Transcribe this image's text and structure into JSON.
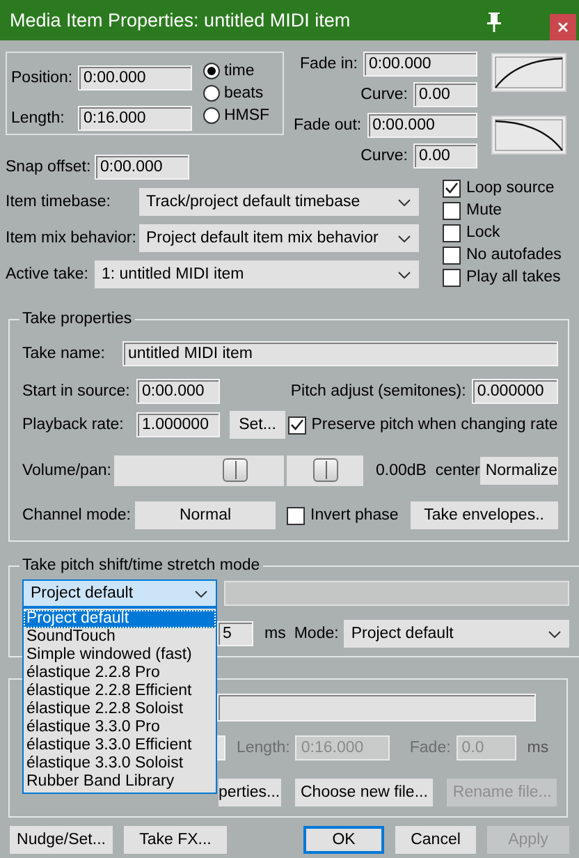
{
  "window": {
    "title": "Media Item Properties:  untitled MIDI item"
  },
  "position": {
    "label": "Position:",
    "value": "0:00.000"
  },
  "length": {
    "label": "Length:",
    "value": "0:16.000"
  },
  "time_format": [
    {
      "label": "time",
      "selected": true
    },
    {
      "label": "beats",
      "selected": false
    },
    {
      "label": "HMSF",
      "selected": false
    }
  ],
  "fade_in": {
    "label": "Fade in:",
    "value": "0:00.000",
    "curve_label": "Curve:",
    "curve": "0.00"
  },
  "fade_out": {
    "label": "Fade out:",
    "value": "0:00.000",
    "curve_label": "Curve:",
    "curve": "0.00"
  },
  "snap_offset": {
    "label": "Snap offset:",
    "value": "0:00.000"
  },
  "settings": [
    {
      "label": "Item timebase:",
      "value": "Track/project default timebase"
    },
    {
      "label": "Item mix behavior:",
      "value": "Project default item mix behavior"
    },
    {
      "label": "Active take:",
      "value": "1: untitled MIDI item"
    }
  ],
  "options": [
    {
      "label": "Loop source",
      "checked": true
    },
    {
      "label": "Mute",
      "checked": false
    },
    {
      "label": "Lock",
      "checked": false
    },
    {
      "label": "No autofades",
      "checked": false
    },
    {
      "label": "Play all takes",
      "checked": false
    }
  ],
  "take": {
    "title": "Take properties",
    "name_label": "Take name:",
    "name": "untitled MIDI item",
    "start_label": "Start in source:",
    "start": "0:00.000",
    "pitch_label": "Pitch adjust (semitones):",
    "pitch": "0.000000",
    "rate_label": "Playback rate:",
    "rate": "1.000000",
    "set_button": "Set...",
    "preserve_pitch": {
      "label": "Preserve pitch when changing rate",
      "checked": true
    },
    "volpan_label": "Volume/pan:",
    "volume": {
      "level": 0.71
    },
    "pan": {
      "level": 0.5
    },
    "volpan_reading": "0.00dB  center",
    "normalize_button": "Normalize",
    "channel_label": "Channel mode:",
    "channel_mode": "Normal",
    "invert_phase": {
      "label": "Invert phase",
      "checked": false
    },
    "envelopes_button": "Take envelopes.."
  },
  "stretch": {
    "title": "Take pitch shift/time stretch mode",
    "mode": "Project default",
    "list": [
      {
        "label": "Project default",
        "selected": true
      },
      {
        "label": "SoundTouch",
        "selected": false
      },
      {
        "label": "Simple windowed (fast)",
        "selected": false
      },
      {
        "label": "élastique 2.2.8 Pro",
        "selected": false
      },
      {
        "label": "élastique 2.2.8 Efficient",
        "selected": false
      },
      {
        "label": "élastique 2.2.8 Soloist",
        "selected": false
      },
      {
        "label": "élastique 3.3.0 Pro",
        "selected": false
      },
      {
        "label": "élastique 3.3.0 Efficient",
        "selected": false
      },
      {
        "label": "élastique 3.3.0 Soloist",
        "selected": false
      },
      {
        "label": "Rubber Band Library",
        "selected": false
      }
    ],
    "window_value": "5",
    "window_unit": "ms",
    "mode_label": "Mode:",
    "submode": "Project default"
  },
  "source": {
    "length_label": "Length:",
    "length": "0:16.000",
    "fade_label": "Fade:",
    "fade": "0.0",
    "fade_unit": "ms",
    "buttons": [
      {
        "label": "perties...",
        "disabled": false
      },
      {
        "label": "Choose new file...",
        "disabled": false
      },
      {
        "label": "Rename file...",
        "disabled": true
      }
    ]
  },
  "buttons": [
    {
      "label": "Nudge/Set...",
      "disabled": false,
      "focused": false
    },
    {
      "label": "Take FX...",
      "disabled": false,
      "focused": false
    },
    {
      "label": "OK",
      "disabled": false,
      "focused": true
    },
    {
      "label": "Cancel",
      "disabled": false,
      "focused": false
    },
    {
      "label": "Apply",
      "disabled": true,
      "focused": false
    }
  ]
}
